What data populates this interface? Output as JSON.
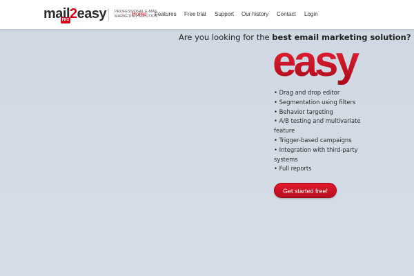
{
  "brand": {
    "logo_main": "mail",
    "logo_two": "2",
    "logo_rest": "easy",
    "logo_badge": "PRO",
    "tagline_line1": "Professional e-mail",
    "tagline_line2": "marketing solution",
    "accent_color": "#d0021b"
  },
  "nav": {
    "items": [
      {
        "label": "Home",
        "active": true
      },
      {
        "label": "Features"
      },
      {
        "label": "Free trial"
      },
      {
        "label": "Support"
      },
      {
        "label": "Our history"
      },
      {
        "label": "Contact"
      },
      {
        "label": "Login"
      }
    ]
  },
  "hero": {
    "question_prefix": "Are you looking for the ",
    "question_bold": "best email marketing solution?",
    "big_word": "easy",
    "features": [
      "Drag and drop editor",
      "Segmentation using filters",
      "Behavior targeting",
      "A/B testing and multivariate feature",
      "Trigger-based campaigns",
      "Integration with third-party systems",
      "Full reports"
    ],
    "cta_label": "Get started free!"
  }
}
